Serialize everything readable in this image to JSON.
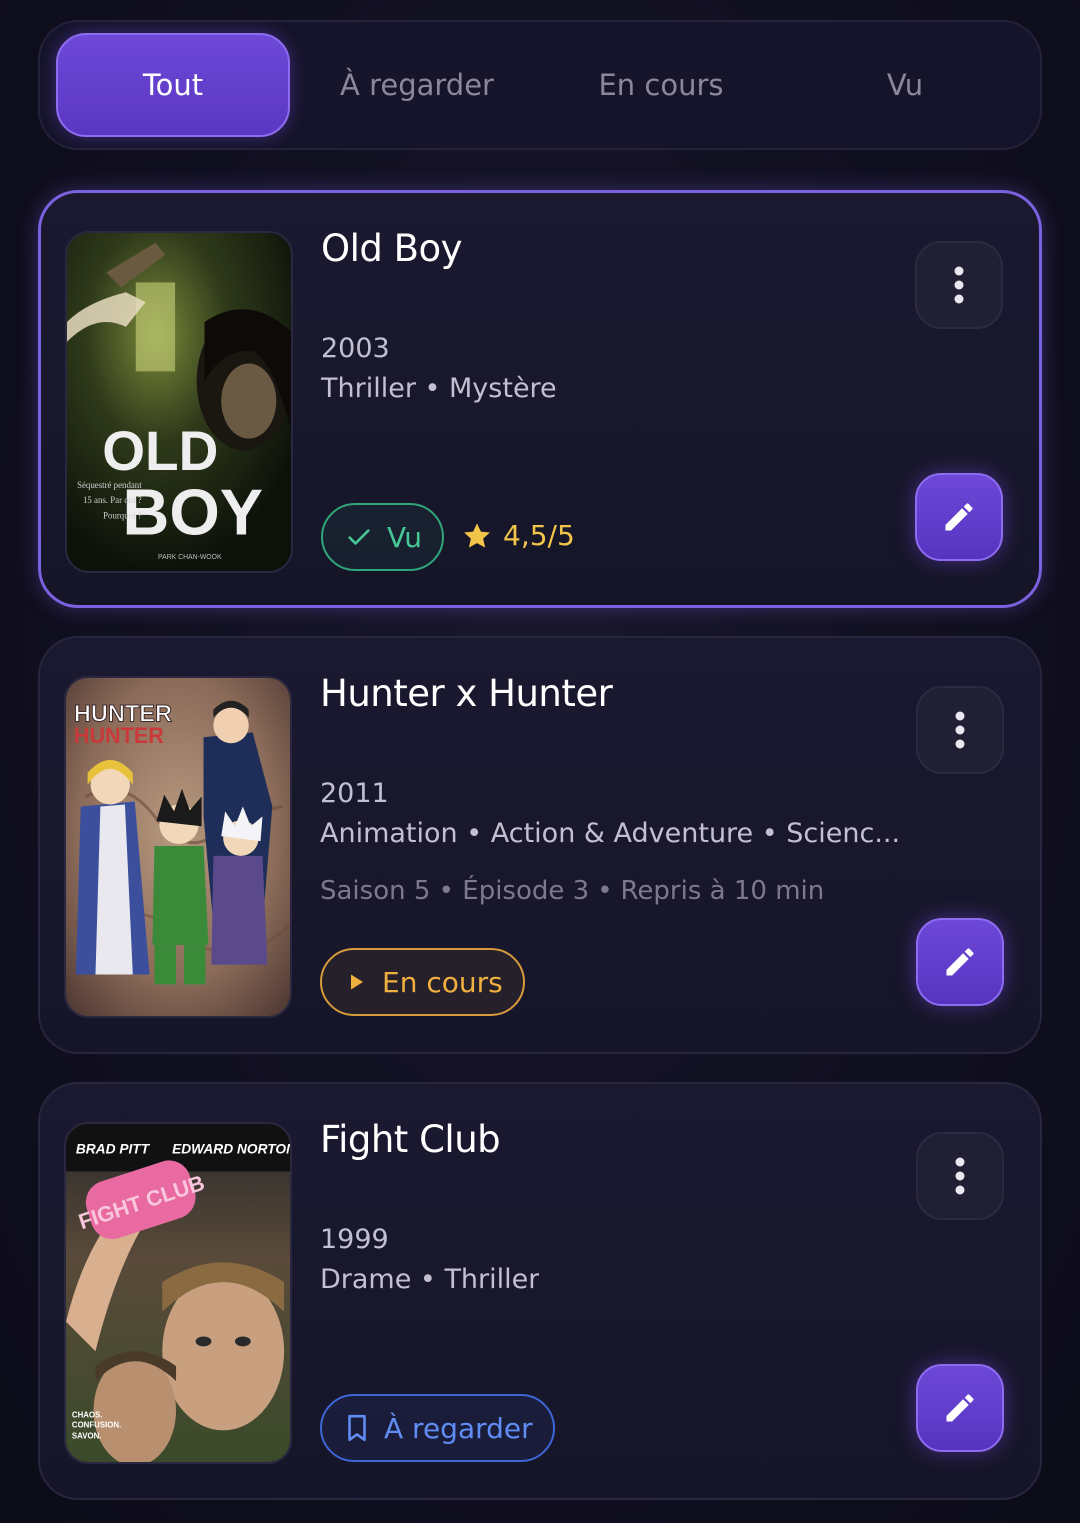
{
  "tabs": [
    {
      "label": "Tout",
      "active": true
    },
    {
      "label": "À regarder",
      "active": false
    },
    {
      "label": "En cours",
      "active": false
    },
    {
      "label": "Vu",
      "active": false
    }
  ],
  "items": [
    {
      "title": "Old Boy",
      "year": "2003",
      "genres": "Thriller • Mystère",
      "status_label": "Vu",
      "status_icon": "check-icon",
      "rating": "4,5/5",
      "poster_text": {
        "line1": "OLD",
        "line2": "BOY",
        "tag": "Séquestré pendant 15 ans. Par qui ? Pourquoi ?",
        "credit": "PARK CHAN-WOOK"
      }
    },
    {
      "title": "Hunter x Hunter",
      "year": "2011",
      "genres": "Animation • Action & Adventure • Scienc...",
      "progress_episode": "Saison 5 • Épisode 3",
      "progress_resume": "Repris à 10 min",
      "status_label": "En cours",
      "status_icon": "play-icon",
      "poster_text": {
        "line1": "HUNTER",
        "line2": "HUNTER"
      }
    },
    {
      "title": "Fight Club",
      "year": "1999",
      "genres": "Drame • Thriller",
      "status_label": "À regarder",
      "status_icon": "bookmark-icon",
      "poster_text": {
        "actor1": "BRAD PITT",
        "actor2": "EDWARD NORTON",
        "soap": "FIGHT CLUB",
        "tag": "CHAOS. CONFUSION. SAVON."
      }
    }
  ],
  "colors": {
    "accent": "#6e48d8",
    "vu": "#47c796",
    "en_cours": "#f0b040",
    "a_regarder": "#5f8df5",
    "star": "#f3c44a"
  }
}
